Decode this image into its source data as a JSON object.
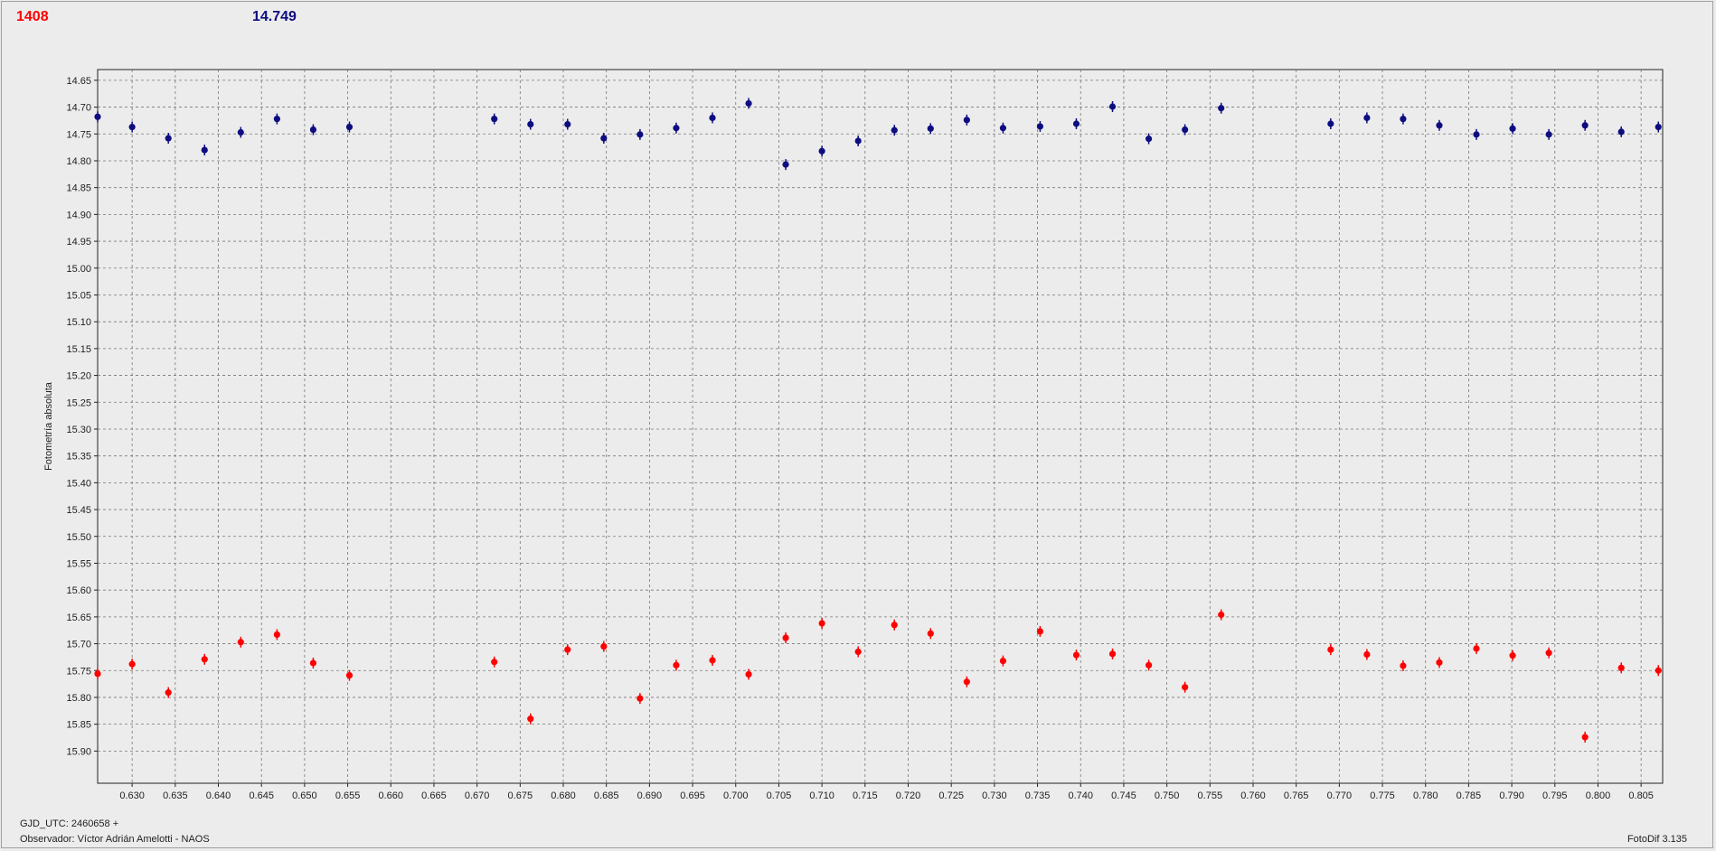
{
  "header": {
    "count_value": "1408",
    "mean_value": "14.749"
  },
  "footer": {
    "gjd_label": "GJD_UTC: 2460658 +",
    "observer_label": "Observador: Víctor Adrián Amelotti - NAOS",
    "software_label": "FotoDif 3.135"
  },
  "colors": {
    "background": "#ececec",
    "plot_background": "#ececec",
    "grid": "#777777",
    "series_blue": "#0d0d80",
    "series_red": "#ff0000"
  },
  "chart_data": {
    "type": "scatter",
    "ylabel": "Fotometría absoluta",
    "xlabel": "",
    "xlim": [
      0.626,
      0.8075
    ],
    "ylim": [
      14.63,
      15.96
    ],
    "y_inverted": true,
    "grid": true,
    "xticks": [
      "0.630",
      "0.635",
      "0.640",
      "0.645",
      "0.650",
      "0.655",
      "0.660",
      "0.665",
      "0.670",
      "0.675",
      "0.680",
      "0.685",
      "0.690",
      "0.695",
      "0.700",
      "0.705",
      "0.710",
      "0.715",
      "0.720",
      "0.725",
      "0.730",
      "0.735",
      "0.740",
      "0.745",
      "0.750",
      "0.755",
      "0.760",
      "0.765",
      "0.770",
      "0.775",
      "0.780",
      "0.785",
      "0.790",
      "0.795",
      "0.800",
      "0.805"
    ],
    "yticks": [
      "14.65",
      "14.70",
      "14.75",
      "14.80",
      "14.85",
      "14.90",
      "14.95",
      "15.00",
      "15.05",
      "15.10",
      "15.15",
      "15.20",
      "15.25",
      "15.30",
      "15.35",
      "15.40",
      "15.45",
      "15.50",
      "15.55",
      "15.60",
      "15.65",
      "15.70",
      "15.75",
      "15.80",
      "15.85",
      "15.90"
    ],
    "series": [
      {
        "color": "#0d0d80",
        "x": [
          0.626,
          0.63,
          0.6342,
          0.6384,
          0.6426,
          0.6468,
          0.651,
          0.6552,
          0.672,
          0.6762,
          0.6805,
          0.6847,
          0.6889,
          0.6931,
          0.6973,
          0.7015,
          0.7058,
          0.71,
          0.7142,
          0.7184,
          0.7226,
          0.7268,
          0.731,
          0.7353,
          0.7395,
          0.7437,
          0.7479,
          0.7521,
          0.7563,
          0.769,
          0.7732,
          0.7774,
          0.7816,
          0.7859,
          0.7901,
          0.7943,
          0.7985,
          0.8027,
          0.807
        ],
        "y": [
          14.718,
          14.737,
          14.758,
          14.78,
          14.747,
          14.722,
          14.742,
          14.737,
          14.722,
          14.732,
          14.732,
          14.758,
          14.751,
          14.739,
          14.72,
          14.693,
          14.807,
          14.782,
          14.763,
          14.743,
          14.74,
          14.724,
          14.739,
          14.736,
          14.731,
          14.699,
          14.759,
          14.742,
          14.702,
          14.731,
          14.72,
          14.722,
          14.734,
          14.751,
          14.74,
          14.751,
          14.734,
          14.746,
          14.737
        ]
      },
      {
        "color": "#ff0000",
        "x": [
          0.626,
          0.63,
          0.6342,
          0.6384,
          0.6426,
          0.6468,
          0.651,
          0.6552,
          0.672,
          0.6762,
          0.6805,
          0.6847,
          0.6889,
          0.6931,
          0.6973,
          0.7015,
          0.7058,
          0.71,
          0.7142,
          0.7184,
          0.7226,
          0.7268,
          0.731,
          0.7353,
          0.7395,
          0.7437,
          0.7479,
          0.7521,
          0.7563,
          0.769,
          0.7732,
          0.7774,
          0.7816,
          0.7859,
          0.7901,
          0.7943,
          0.7985,
          0.8027,
          0.807
        ],
        "y": [
          15.756,
          15.738,
          15.791,
          15.729,
          15.697,
          15.683,
          15.736,
          15.759,
          15.734,
          15.84,
          15.711,
          15.705,
          15.802,
          15.74,
          15.731,
          15.757,
          15.689,
          15.662,
          15.715,
          15.665,
          15.681,
          15.771,
          15.732,
          15.677,
          15.721,
          15.719,
          15.74,
          15.781,
          15.646,
          15.711,
          15.72,
          15.741,
          15.735,
          15.709,
          15.722,
          15.717,
          15.874,
          15.745,
          15.75
        ]
      }
    ]
  }
}
